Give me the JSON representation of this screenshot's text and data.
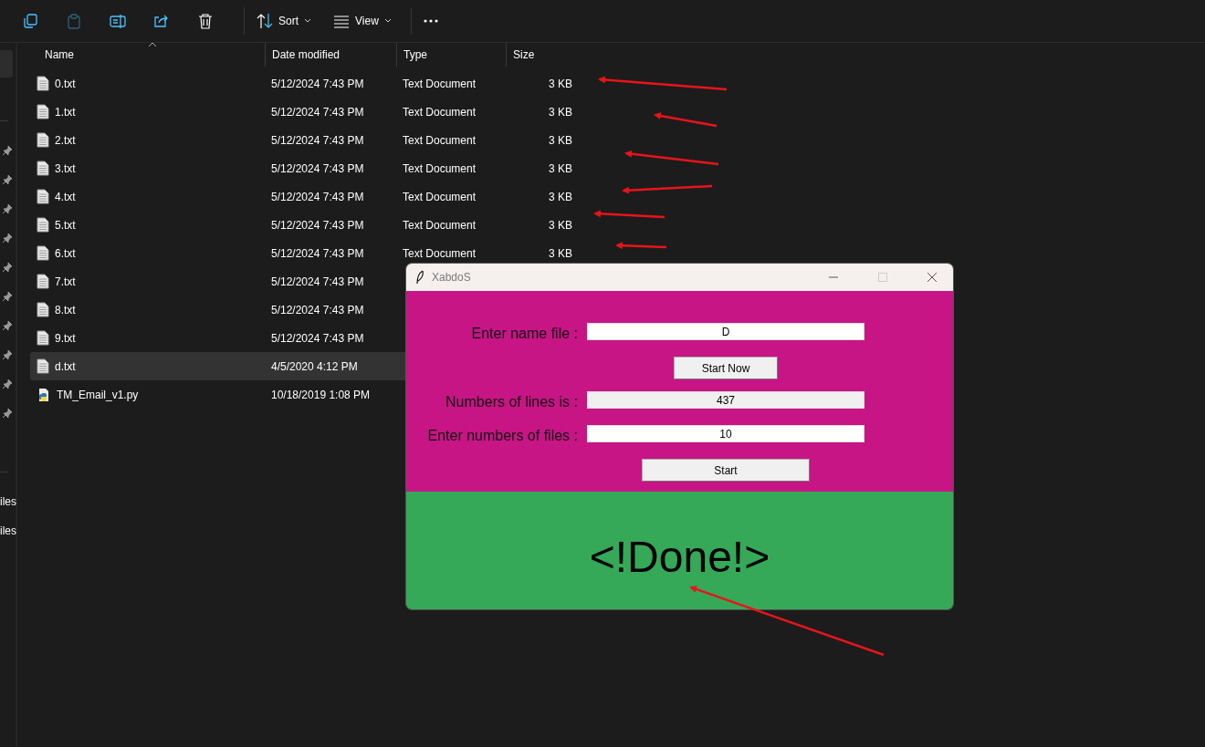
{
  "toolbar": [
    {
      "kind": "copy",
      "disabled": false
    },
    {
      "kind": "paste",
      "disabled": true
    },
    {
      "kind": "rename",
      "disabled": false
    },
    {
      "kind": "share",
      "disabled": false
    },
    {
      "kind": "delete",
      "disabled": false
    },
    {
      "kind": "separator"
    },
    {
      "kind": "sort",
      "label": "Sort"
    },
    {
      "kind": "view",
      "label": "View"
    },
    {
      "kind": "separator"
    },
    {
      "kind": "more"
    }
  ],
  "sidebar": {
    "items": [
      {
        "label": "iles"
      },
      {
        "label": "iles"
      }
    ]
  },
  "file_list": {
    "columns": [
      "Name",
      "Date modified",
      "Type",
      "Size"
    ],
    "rows": [
      {
        "kind": "text",
        "name": "0.txt",
        "date": "5/12/2024 7:43 PM",
        "type": "Text Document",
        "size": "3 KB",
        "selected": false
      },
      {
        "kind": "text",
        "name": "1.txt",
        "date": "5/12/2024 7:43 PM",
        "type": "Text Document",
        "size": "3 KB",
        "selected": false
      },
      {
        "kind": "text",
        "name": "2.txt",
        "date": "5/12/2024 7:43 PM",
        "type": "Text Document",
        "size": "3 KB",
        "selected": false
      },
      {
        "kind": "text",
        "name": "3.txt",
        "date": "5/12/2024 7:43 PM",
        "type": "Text Document",
        "size": "3 KB",
        "selected": false
      },
      {
        "kind": "text",
        "name": "4.txt",
        "date": "5/12/2024 7:43 PM",
        "type": "Text Document",
        "size": "3 KB",
        "selected": false
      },
      {
        "kind": "text",
        "name": "5.txt",
        "date": "5/12/2024 7:43 PM",
        "type": "Text Document",
        "size": "3 KB",
        "selected": false
      },
      {
        "kind": "text",
        "name": "6.txt",
        "date": "5/12/2024 7:43 PM",
        "type": "Text Document",
        "size": "3 KB",
        "selected": false
      },
      {
        "kind": "text",
        "name": "7.txt",
        "date": "5/12/2024 7:43 PM",
        "selected": false
      },
      {
        "kind": "text",
        "name": "8.txt",
        "date": "5/12/2024 7:43 PM",
        "selected": false
      },
      {
        "kind": "text",
        "name": "9.txt",
        "date": "5/12/2024 7:43 PM",
        "selected": false
      },
      {
        "kind": "text",
        "name": "d.txt",
        "date": "4/5/2020 4:12 PM",
        "selected": true
      },
      {
        "kind": "python",
        "name": "TM_Email_v1.py",
        "date": "10/18/2019 1:08 PM",
        "selected": false
      }
    ]
  },
  "dialog": {
    "title": "XabdoS",
    "form": [
      {
        "kind": "field",
        "label": "Enter name file :",
        "value": "D",
        "readonly": false
      },
      {
        "kind": "button",
        "label": "Start Now"
      },
      {
        "kind": "field",
        "label": "Numbers of lines is :",
        "value": "437",
        "readonly": true
      },
      {
        "kind": "field",
        "label": "Enter numbers of files :",
        "value": "10",
        "readonly": false
      },
      {
        "kind": "button",
        "label": "Start"
      }
    ],
    "status": "<!Done!>"
  }
}
